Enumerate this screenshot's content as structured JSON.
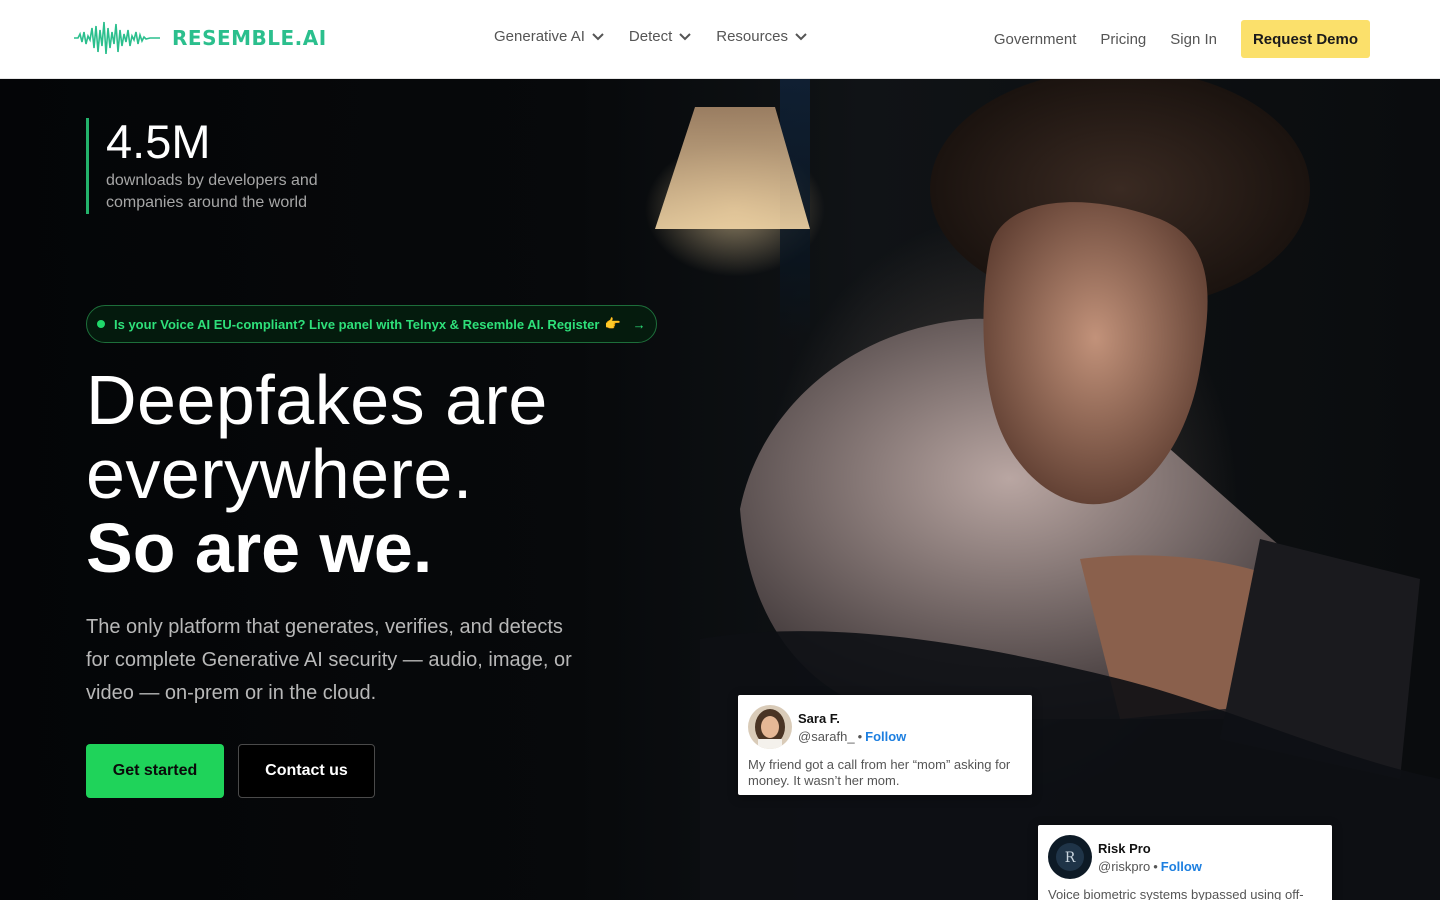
{
  "nav": {
    "logo_text": "RESEMBLE.AI",
    "menus": [
      {
        "label": "Generative AI"
      },
      {
        "label": "Detect"
      },
      {
        "label": "Resources"
      }
    ],
    "links": [
      {
        "label": "Government"
      },
      {
        "label": "Pricing"
      },
      {
        "label": "Sign In"
      }
    ],
    "cta_label": "Request Demo"
  },
  "hero": {
    "stat": {
      "number": "4.5M",
      "line1": "downloads by developers and",
      "line2": "companies around the world"
    },
    "banner": {
      "text": "Is your Voice AI EU-compliant? Live panel with Telnyx & Resemble AI. Register",
      "emoji": "👉",
      "arrow": "→"
    },
    "headline": {
      "line1": "Deepfakes are",
      "line2": "everywhere.",
      "line3": "So are we."
    },
    "subtext": "The only platform that generates, verifies, and detects for complete Generative AI security — audio, image, or video — on-prem or in the cloud.",
    "primary_button": "Get started",
    "secondary_button": "Contact us"
  },
  "cards": [
    {
      "name": "Sara F.",
      "handle": "@sarafh_",
      "sep": "•",
      "follow": "Follow",
      "body": "My friend got a call from her “mom” asking for money. It wasn’t her mom."
    },
    {
      "name": "Risk Pro",
      "handle": "@riskpro",
      "sep": "•",
      "follow": "Follow",
      "body": "Voice biometric systems bypassed using off-"
    }
  ],
  "colors": {
    "brand_green": "#2bbf8d",
    "cta_yellow": "#fbe06b",
    "primary_green": "#1fd35a",
    "follow_blue": "#1d7fe0"
  }
}
